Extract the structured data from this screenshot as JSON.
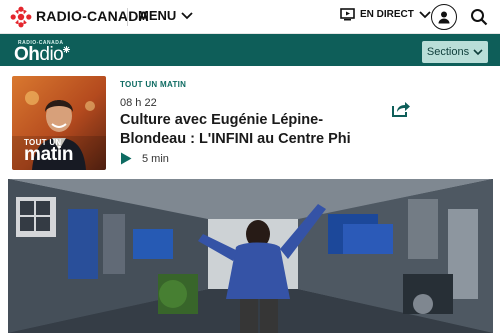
{
  "header": {
    "brand": "RADIO-CANADA",
    "menu_label": "MENU",
    "live_label": "EN DIRECT"
  },
  "ohdio": {
    "small_label": "RADIO-CANADA",
    "logo_oh": "Oh",
    "logo_dio": "dio",
    "sections_label": "Sections"
  },
  "episode": {
    "show_name": "TOUT UN MATIN",
    "time": "08 h 22",
    "title": "Culture avec Eugénie Lépine-Blondeau : L'INFINI au Centre Phi",
    "duration": "5 min",
    "thumb_line1": "TOUT UN",
    "thumb_line2": "matin"
  },
  "colors": {
    "ohdio_green": "#0e5e59",
    "accent_green": "#0e6b62",
    "rc_red": "#e4262d"
  }
}
